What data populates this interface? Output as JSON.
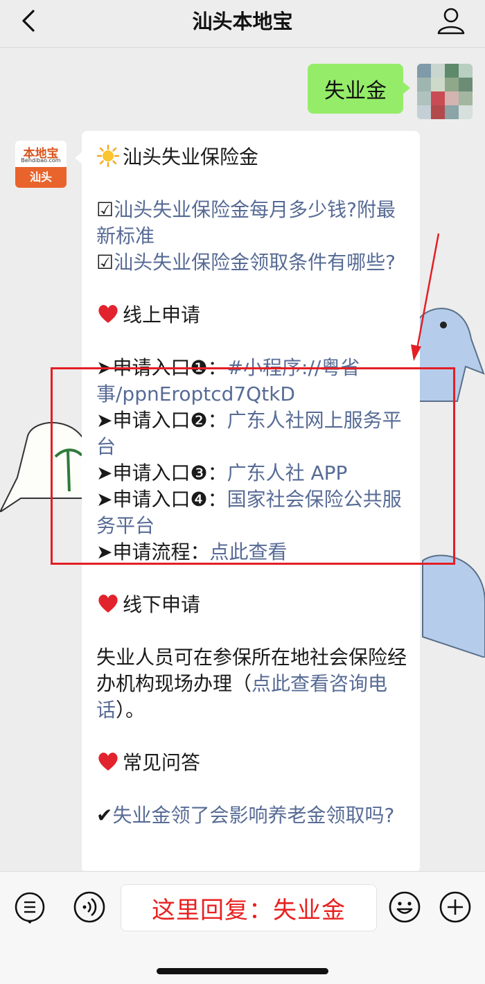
{
  "header": {
    "title": "汕头本地宝"
  },
  "conversation": {
    "user_message": "失业金",
    "bot_avatar": {
      "logo_text": "本地宝",
      "logo_sub": "Bendibao.com",
      "city": "汕头"
    },
    "bot_message": {
      "heading": "汕头失业保险金",
      "links_top": [
        {
          "prefix": "☑",
          "text": "汕头失业保险金每月多少钱?附最新标准"
        },
        {
          "prefix": "☑",
          "text": "汕头失业保险金领取条件有哪些?"
        }
      ],
      "online_heading": "线上申请",
      "entries": [
        {
          "label": "➤申请入口❶：",
          "link": "#小程序://粤省事/ppnEroptcd7QtkD"
        },
        {
          "label": "➤申请入口❷：",
          "link": "广东人社网上服务平台"
        },
        {
          "label": "➤申请入口❸：",
          "link": "广东人社 APP"
        },
        {
          "label": "➤申请入口❹：",
          "link": "国家社会保险公共服务平台"
        }
      ],
      "process": {
        "label": "➤申请流程：",
        "link": "点此查看"
      },
      "offline_heading": "线下申请",
      "offline_text_before": "失业人员可在参保所在地社会保险经办机构现场办理（",
      "offline_link": "点此查看咨询电话",
      "offline_text_after": "）。",
      "faq_heading": "常见问答",
      "faq_prefix": "✔",
      "faq_link": "失业金领了会影响养老金领取吗?"
    }
  },
  "input": {
    "text": "这里回复：失业金"
  },
  "icons": {
    "back": "chevron-left-icon",
    "profile": "person-icon",
    "menu": "list-menu-icon",
    "voice": "voice-icon",
    "emoji": "smiley-icon",
    "plus": "plus-icon"
  },
  "colors": {
    "link": "#576b95",
    "user_bubble": "#95ec69",
    "highlight_frame": "#e31e24",
    "input_text": "#e8201f"
  }
}
